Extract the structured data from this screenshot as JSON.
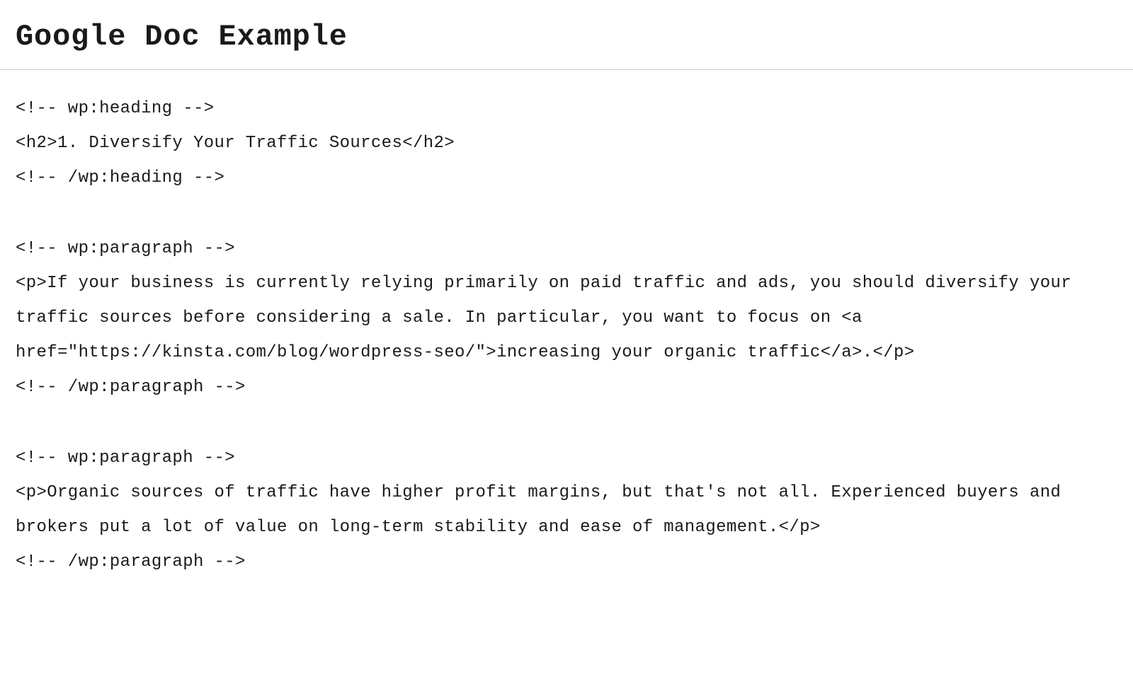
{
  "header": {
    "title": "Google Doc Example"
  },
  "content": {
    "lines": [
      "<!-- wp:heading -->",
      "<h2>1. Diversify Your Traffic Sources</h2>",
      "<!-- /wp:heading -->",
      "",
      "<!-- wp:paragraph -->",
      "<p>If your business is currently relying primarily on paid traffic and ads, you should diversify your traffic sources before considering a sale. In particular, you want to focus on <a href=\"https://kinsta.com/blog/wordpress-seo/\">increasing your organic traffic</a>.</p>",
      "<!-- /wp:paragraph -->",
      "",
      "<!-- wp:paragraph -->",
      "<p>Organic sources of traffic have higher profit margins, but that's not all. Experienced buyers and brokers put a lot of value on long-term stability and ease of management.</p>",
      "<!-- /wp:paragraph -->"
    ]
  }
}
